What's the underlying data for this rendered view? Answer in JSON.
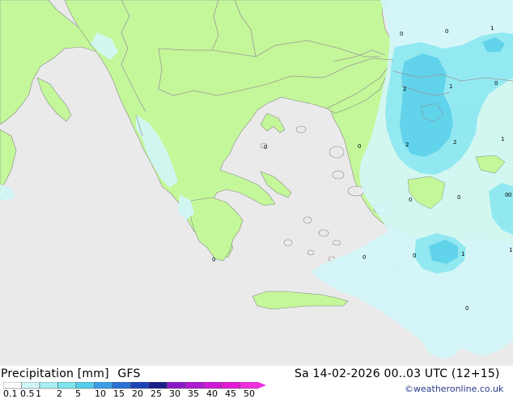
{
  "map": {
    "value_labels": [
      "0",
      "0",
      "1",
      "1",
      "2",
      "1",
      "0",
      "0",
      "2",
      "2",
      "1",
      "0",
      "0",
      "0",
      "0",
      "0",
      "0",
      "0",
      "1",
      "0",
      "0"
    ]
  },
  "footer": {
    "title": "Precipitation [mm]",
    "model": "GFS",
    "datetime": "Sa 14-02-2026 00..03 UTC (12+15)",
    "credit": "©weatheronline.co.uk",
    "legend_values": [
      "0.1",
      "0.5",
      "1",
      "2",
      "5",
      "10",
      "15",
      "20",
      "25",
      "30",
      "35",
      "40",
      "45",
      "50"
    ],
    "legend_colors": [
      "#fdfdfd",
      "#d0f6f8",
      "#a8eef2",
      "#7fe4ee",
      "#56cdea",
      "#3a9ee6",
      "#2c6fd6",
      "#1e43b8",
      "#1a1f8a",
      "#8a1ac8",
      "#b01ad0",
      "#d018d8",
      "#e41ad8",
      "#f030e0"
    ]
  },
  "colors": {
    "sea": "#eaeaea",
    "land": "#c4f79a",
    "precip_light": "#d2f6f8",
    "precip_mid": "#8fe8f0",
    "precip_strong": "#5fd2ea",
    "border": "#999999"
  }
}
